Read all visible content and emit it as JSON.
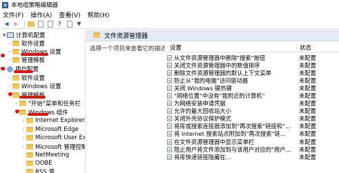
{
  "window": {
    "title": "本地组策略编辑器"
  },
  "menu": [
    {
      "label": "文件(F)"
    },
    {
      "label": "操作(A)"
    },
    {
      "label": "查看(V)"
    },
    {
      "label": "帮助(H)"
    }
  ],
  "toolbar": {
    "icons": [
      "back-arrow-icon",
      "forward-arrow-icon",
      "folder-up-icon",
      "properties-sheet-icon",
      "help-icon",
      "filter-icon"
    ]
  },
  "tree": {
    "items": [
      {
        "label": "计算机配置"
      },
      {
        "label": "软件设置"
      },
      {
        "label": "Windows 设置"
      },
      {
        "label": "管理模板"
      },
      {
        "label": "用户配置"
      },
      {
        "label": "软件设置"
      },
      {
        "label": "Windows 设置"
      },
      {
        "label": "管理模板"
      },
      {
        "label": "\"开始\"菜单和任务栏"
      },
      {
        "label": "Windows 组件"
      },
      {
        "label": "Internet Explorer"
      },
      {
        "label": "Microsoft Edge"
      },
      {
        "label": "Microsoft User Exp"
      },
      {
        "label": "Microsoft 管理控制"
      },
      {
        "label": "NetMeeting"
      },
      {
        "label": "OOBE"
      },
      {
        "label": "RSS 源"
      }
    ]
  },
  "panel": {
    "title": "文件资源管理器",
    "description": "选择一个项目来查看它的描述。",
    "columns": {
      "setting": "设置",
      "state": "状态"
    },
    "rows": [
      {
        "setting": "从文件资源管理器中删除\"搜索\"按钮",
        "state": "未配置"
      },
      {
        "setting": "关闭文件资源管理器中的数值排序",
        "state": "未配置"
      },
      {
        "setting": "删除文件资源管理器的默认上下文菜单",
        "state": "未配置"
      },
      {
        "setting": "防止从\"我的电脑\"访问驱动器",
        "state": "未配置"
      },
      {
        "setting": "关闭 Windows 键热键",
        "state": "未配置"
      },
      {
        "setting": "\"网络位置\"中没有\"我附近的计算机\"",
        "state": "未配置"
      },
      {
        "setting": "为网络安装申请凭据",
        "state": "未配置"
      },
      {
        "setting": "允许的最大回收站大小",
        "state": "未配置"
      },
      {
        "setting": "关闭外壳协议保护模式",
        "state": "未配置"
      },
      {
        "setting": "将库或搜索连接器添加到\"再次搜索\"链接和\"...",
        "state": "未配置"
      },
      {
        "setting": "将 Internet 搜索站点附加到\"再次搜索\"链...",
        "state": "未配置"
      },
      {
        "setting": "在文件资源管理器中显示菜单栏",
        "state": "未配置"
      },
      {
        "setting": "阻止用户将文件添加到与该用户对应的\"用户...",
        "state": "未配置"
      },
      {
        "setting": "将库快速链接隐藏在...",
        "state": "未配置"
      }
    ]
  }
}
